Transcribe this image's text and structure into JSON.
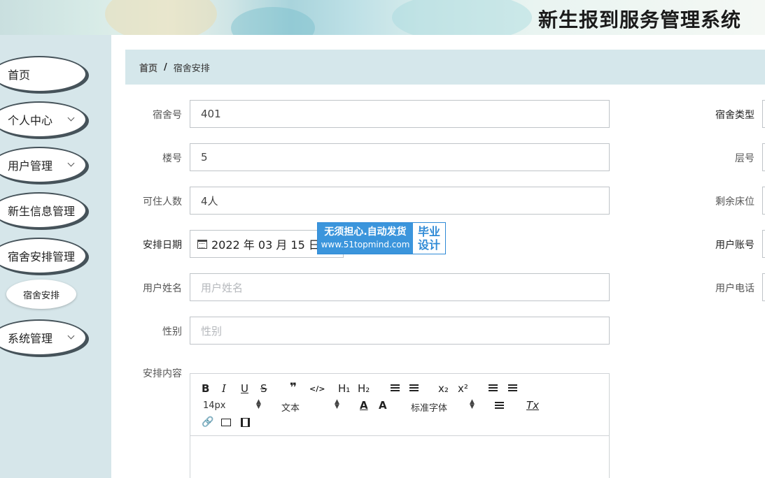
{
  "header": {
    "title": "新生报到服务管理系统"
  },
  "sidebar": {
    "items": [
      {
        "label": "首页",
        "has_children": false
      },
      {
        "label": "个人中心",
        "has_children": true
      },
      {
        "label": "用户管理",
        "has_children": true
      },
      {
        "label": "新生信息管理",
        "has_children": false
      },
      {
        "label": "宿舍安排管理",
        "has_children": false
      },
      {
        "label": "系统管理",
        "has_children": true
      }
    ],
    "submenu": {
      "label": "宿舍安排"
    }
  },
  "breadcrumb": {
    "home": "首页",
    "separator": "/",
    "current": "宿舍安排"
  },
  "form": {
    "dorm_no": {
      "label": "宿舍号",
      "value": "401"
    },
    "building_no": {
      "label": "楼号",
      "value": "5"
    },
    "capacity": {
      "label": "可住人数",
      "value": "4人"
    },
    "arrange_date": {
      "label": "安排日期",
      "value": "2022 年 03 月 15 日"
    },
    "user_name": {
      "label": "用户姓名",
      "placeholder": "用户姓名"
    },
    "gender": {
      "label": "性别",
      "placeholder": "性别"
    },
    "content": {
      "label": "安排内容"
    },
    "right_labels": {
      "dorm_type": "宿舍类型",
      "floor_no": "层号",
      "remaining_beds": "剩余床位",
      "user_account": "用户账号",
      "user_phone": "用户电话"
    }
  },
  "editor": {
    "buttons": {
      "bold": "B",
      "italic": "I",
      "underline": "U",
      "strike": "S",
      "blockquote": "❞",
      "code": "</>",
      "h1": "H₁",
      "h2": "H₂",
      "sub": "x₂",
      "sup": "x²"
    },
    "font_size": "14px",
    "paragraph": "文本",
    "font_family": "标准字体",
    "clean": "Tx"
  },
  "watermark": {
    "line1": "无须担心.自动发货",
    "line2": "www.51topmind.com",
    "badge_line1": "毕业",
    "badge_line2": "设计"
  }
}
